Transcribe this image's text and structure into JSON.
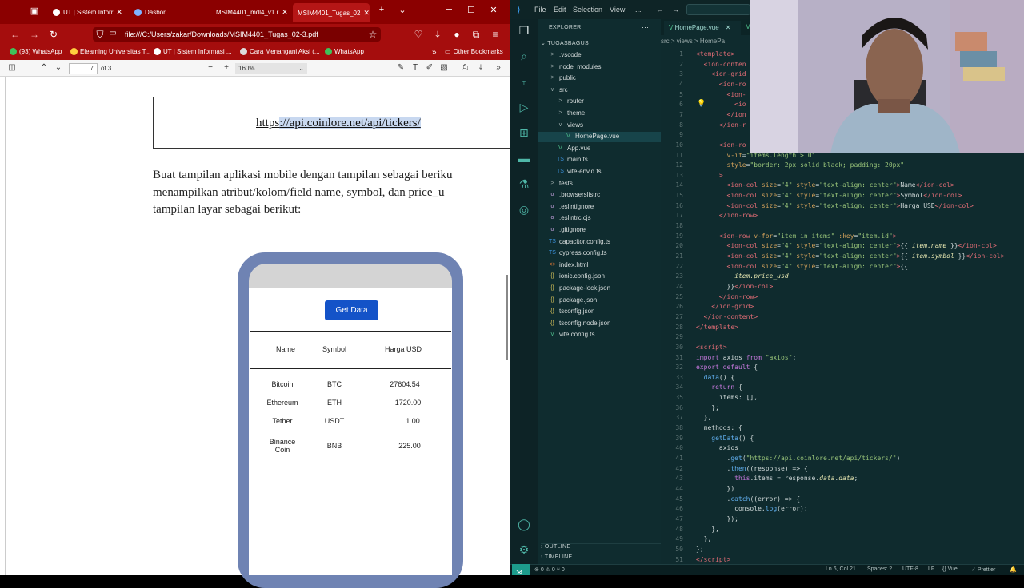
{
  "browser": {
    "tabs": [
      {
        "label": "UT | Sistem Inforr"
      },
      {
        "label": "Dasbor"
      },
      {
        "label": "MSIM4401_mdl4_v1.r"
      },
      {
        "label": "MSIM4401_Tugas_02"
      }
    ],
    "url": "file:///C:/Users/zakar/Downloads/MSIM4401_Tugas_02-3.pdf",
    "bookmarks": [
      {
        "label": "(93) WhatsApp"
      },
      {
        "label": "Elearning Universitas T..."
      },
      {
        "label": "UT | Sistem Informasi ..."
      },
      {
        "label": "Cara Menangani Aksi (..."
      },
      {
        "label": "WhatsApp"
      }
    ],
    "other_bookmarks": "Other Bookmarks",
    "pdf_toolbar": {
      "page": "7",
      "page_count": "of 3",
      "zoom": "160%"
    }
  },
  "pdf": {
    "link_prefix": "https",
    "link_selected": "://api.coinlore.net/api/tickers/",
    "para_lines": [
      "Buat tampilan aplikasi mobile dengan tampilan sebagai beriku",
      "menampilkan atribut/kolom/field name, symbol, dan price_u",
      "tampilan layar sebagai berikut:"
    ],
    "phone": {
      "button": "Get Data",
      "headers": [
        "Name",
        "Symbol",
        "Harga USD"
      ],
      "rows": [
        {
          "name": "Bitcoin",
          "symbol": "BTC",
          "price": "27604.54"
        },
        {
          "name": "Ethereum",
          "symbol": "ETH",
          "price": "1720.00"
        },
        {
          "name": "Tether",
          "symbol": "USDT",
          "price": "1.00"
        },
        {
          "name": "Binance\nCoin",
          "symbol": "BNB",
          "price": "225.00"
        }
      ]
    }
  },
  "vscode": {
    "menu": [
      "File",
      "Edit",
      "Selection",
      "View",
      "..."
    ],
    "explorer_label": "EXPLORER",
    "project": "TUGASBAGUS",
    "tree": [
      {
        "label": ".vscode",
        "icon": ">",
        "indent": 1
      },
      {
        "label": "node_modules",
        "icon": ">",
        "indent": 1
      },
      {
        "label": "public",
        "icon": ">",
        "indent": 1
      },
      {
        "label": "src",
        "icon": "v",
        "indent": 1
      },
      {
        "label": "router",
        "icon": ">",
        "indent": 2
      },
      {
        "label": "theme",
        "icon": ">",
        "indent": 2
      },
      {
        "label": "views",
        "icon": "v",
        "indent": 2
      },
      {
        "label": "HomePage.vue",
        "icon": "V",
        "indent": 3
      },
      {
        "label": "App.vue",
        "icon": "V",
        "indent": 2
      },
      {
        "label": "main.ts",
        "icon": "TS",
        "indent": 2
      },
      {
        "label": "vite-env.d.ts",
        "icon": "TS",
        "indent": 2
      },
      {
        "label": "tests",
        "icon": ">",
        "indent": 1
      },
      {
        "label": ".browserslistrc",
        "icon": "o",
        "indent": 1
      },
      {
        "label": ".eslintignore",
        "icon": "o",
        "indent": 1
      },
      {
        "label": ".eslintrc.cjs",
        "icon": "o",
        "indent": 1
      },
      {
        "label": ".gitignore",
        "icon": "o",
        "indent": 1
      },
      {
        "label": "capacitor.config.ts",
        "icon": "TS",
        "indent": 1
      },
      {
        "label": "cypress.config.ts",
        "icon": "TS",
        "indent": 1
      },
      {
        "label": "index.html",
        "icon": "<>",
        "indent": 1
      },
      {
        "label": "ionic.config.json",
        "icon": "{}",
        "indent": 1
      },
      {
        "label": "package-lock.json",
        "icon": "{}",
        "indent": 1
      },
      {
        "label": "package.json",
        "icon": "{}",
        "indent": 1
      },
      {
        "label": "tsconfig.json",
        "icon": "{}",
        "indent": 1
      },
      {
        "label": "tsconfig.node.json",
        "icon": "{}",
        "indent": 1
      },
      {
        "label": "vite.config.ts",
        "icon": "V",
        "indent": 1
      }
    ],
    "outline": "OUTLINE",
    "timeline": "TIMELINE",
    "tab": "HomePage.vue",
    "breadcrumb": "src > views > HomePa",
    "status": {
      "position": "Ln 6, Col 21",
      "spaces": "Spaces: 2",
      "encoding": "UTF-8",
      "eol": "LF",
      "lang": "Vue",
      "prettier": "Prettier",
      "errors": "0",
      "warnings": "0",
      "ports": "0"
    }
  }
}
